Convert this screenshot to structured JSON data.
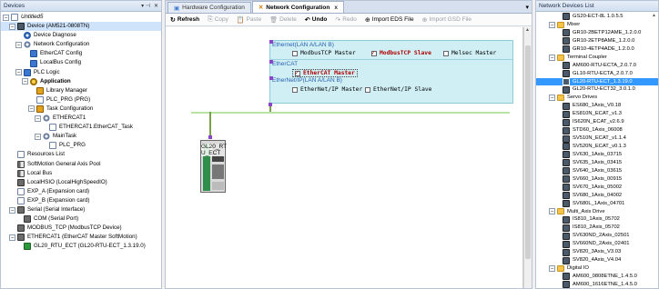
{
  "left_panel": {
    "title": "Devices",
    "header_icons": [
      "pin-icon",
      "close-icon"
    ],
    "items": [
      {
        "label": "Untitled5",
        "indent": 0,
        "exp": "-",
        "icon": "doc",
        "italic": true
      },
      {
        "label": "Device (AM521-0808TN)",
        "indent": 1,
        "exp": "-",
        "icon": "dev",
        "sel": true
      },
      {
        "label": "Device Diagnose",
        "indent": 2,
        "exp": "",
        "icon": "eth"
      },
      {
        "label": "Network Configuration",
        "indent": 2,
        "exp": "-",
        "icon": "gear"
      },
      {
        "label": "EtherCAT Config",
        "indent": 3,
        "exp": "",
        "icon": "blue"
      },
      {
        "label": "LocalBus Config",
        "indent": 3,
        "exp": "",
        "icon": "blue"
      },
      {
        "label": "PLC Logic",
        "indent": 2,
        "exp": "-",
        "icon": "blue"
      },
      {
        "label": "Application",
        "indent": 3,
        "exp": "-",
        "icon": "app",
        "bold": true
      },
      {
        "label": "Library Manager",
        "indent": 4,
        "exp": "",
        "icon": "lib"
      },
      {
        "label": "PLC_PRG (PRG)",
        "indent": 4,
        "exp": "",
        "icon": "doc"
      },
      {
        "label": "Task Configuration",
        "indent": 4,
        "exp": "-",
        "icon": "lib"
      },
      {
        "label": "ETHERCAT1",
        "indent": 5,
        "exp": "-",
        "icon": "gear"
      },
      {
        "label": "ETHERCAT1.EtherCAT_Task",
        "indent": 6,
        "exp": "",
        "icon": "doc"
      },
      {
        "label": "MainTask",
        "indent": 5,
        "exp": "-",
        "icon": "gear"
      },
      {
        "label": "PLC_PRG",
        "indent": 6,
        "exp": "",
        "icon": "doc"
      },
      {
        "label": "Resources List",
        "indent": 1,
        "exp": "",
        "icon": "doc"
      },
      {
        "label": "SoftMotion General Axis Pool",
        "indent": 1,
        "exp": "",
        "icon": "cable"
      },
      {
        "label": "Local Bus",
        "indent": 1,
        "exp": "",
        "icon": "cable"
      },
      {
        "label": "LocalHSIO (LocalHighSpeedIO)",
        "indent": 1,
        "exp": "",
        "icon": "chip"
      },
      {
        "label": "EXP_A (Expansion card)",
        "indent": 1,
        "exp": "",
        "icon": "doc"
      },
      {
        "label": "EXP_B (Expansion card)",
        "indent": 1,
        "exp": "",
        "icon": "doc"
      },
      {
        "label": "Serial (Serial Interface)",
        "indent": 1,
        "exp": "-",
        "icon": "chip"
      },
      {
        "label": "COM (Serial Port)",
        "indent": 2,
        "exp": "",
        "icon": "chip"
      },
      {
        "label": "MODBUS_TCP (ModbusTCP Device)",
        "indent": 1,
        "exp": "",
        "icon": "chip"
      },
      {
        "label": "ETHERCAT1 (EtherCAT Master SoftMotion)",
        "indent": 1,
        "exp": "-",
        "icon": "chip"
      },
      {
        "label": "GL20_RTU_ECT (GL20-RTU-ECT_1.3.19.0)",
        "indent": 2,
        "exp": "",
        "icon": "green"
      }
    ]
  },
  "center": {
    "tabs": [
      {
        "label": "Hardware Configuration",
        "active": false
      },
      {
        "label": "Network Configuration",
        "active": true,
        "close": "x"
      }
    ],
    "toolbar": [
      {
        "label": "Refresh",
        "icon": "↻",
        "enabled": true,
        "bold": true
      },
      {
        "label": "Copy",
        "icon": "⎘",
        "enabled": false
      },
      {
        "label": "Paste",
        "icon": "📋",
        "enabled": false
      },
      {
        "label": "Delete",
        "icon": "🗑",
        "enabled": false
      },
      {
        "label": "Undo",
        "icon": "↶",
        "enabled": true,
        "bold": true
      },
      {
        "label": "Redo",
        "icon": "↷",
        "enabled": false
      },
      {
        "label": "Import EDS File",
        "icon": "⊕",
        "enabled": true
      },
      {
        "label": "Import GSD File",
        "icon": "⊕",
        "enabled": false
      }
    ],
    "protocols": {
      "ethernet_header": "Ethernet(LAN A/LAN B)",
      "modbus_master": "ModbusTCP Master",
      "modbus_slave": "ModbusTCP Slave",
      "melsec_master": "Melsec Master",
      "ethercat_header": "EtherCAT",
      "ethercat_master": "EtherCAT Master",
      "ethernetip_header": "EtherNet/IP(LAN A/LAN B)",
      "ethernetip_master": "EtherNet/IP Master",
      "ethernetip_slave": "EtherNet/IP Slave"
    },
    "checked": {
      "modbus_master": false,
      "modbus_slave": true,
      "melsec_master": false,
      "ethercat_master": true,
      "ethernetip_master": false,
      "ethernetip_slave": false
    },
    "bus_label": "EtherCAT",
    "device_label": "GL20_RT U_ECT"
  },
  "right_panel": {
    "title": "Network Devices List",
    "items": [
      {
        "label": "GS20-ECT-8L 1.0.5.5",
        "indent": 3,
        "exp": "",
        "icon": "dev"
      },
      {
        "label": "Mixer",
        "indent": 2,
        "exp": "-",
        "icon": "folder"
      },
      {
        "label": "GR10-2BETP12AME_1.2.0.0",
        "indent": 3,
        "exp": "",
        "icon": "dev"
      },
      {
        "label": "GR10-2ETP8AME_1.2.0.0",
        "indent": 3,
        "exp": "",
        "icon": "dev"
      },
      {
        "label": "GR10-4ETP4ADE_1.2.0.0",
        "indent": 3,
        "exp": "",
        "icon": "dev"
      },
      {
        "label": "Terminal Coupler",
        "indent": 2,
        "exp": "-",
        "icon": "folder"
      },
      {
        "label": "AM600-RTU-ECTA_2.0.7.0",
        "indent": 3,
        "exp": "",
        "icon": "dev"
      },
      {
        "label": "GL10-RTU-ECTA_2.0.7.0",
        "indent": 3,
        "exp": "",
        "icon": "dev"
      },
      {
        "label": "GL20-RTU-ECT_1.3.19.0",
        "indent": 3,
        "exp": "",
        "icon": "dev",
        "sel": true
      },
      {
        "label": "GL20-RTU-ECT32_3.0.1.0",
        "indent": 3,
        "exp": "",
        "icon": "dev"
      },
      {
        "label": "Servo Drives",
        "indent": 2,
        "exp": "-",
        "icon": "folder"
      },
      {
        "label": "ES680_1Axis_V0.18",
        "indent": 3,
        "exp": "",
        "icon": "dev"
      },
      {
        "label": "ES810N_ECAT_v1.3",
        "indent": 3,
        "exp": "",
        "icon": "dev"
      },
      {
        "label": "IS620N_ECAT_v2.6.9",
        "indent": 3,
        "exp": "",
        "icon": "dev"
      },
      {
        "label": "STD60_1Axis_06008",
        "indent": 3,
        "exp": "",
        "icon": "dev"
      },
      {
        "label": "SV510N_ECAT_v1.1.4",
        "indent": 3,
        "exp": "",
        "icon": "dev"
      },
      {
        "label": "SV520N_ECAT_v0.1.3",
        "indent": 3,
        "exp": "",
        "icon": "dev"
      },
      {
        "label": "SV630_1Axis_03715",
        "indent": 3,
        "exp": "",
        "icon": "dev"
      },
      {
        "label": "SV635_1Axis_03415",
        "indent": 3,
        "exp": "",
        "icon": "dev"
      },
      {
        "label": "SV640_1Axis_03615",
        "indent": 3,
        "exp": "",
        "icon": "dev"
      },
      {
        "label": "SV660_1Axis_00915",
        "indent": 3,
        "exp": "",
        "icon": "dev"
      },
      {
        "label": "SV670_1Axis_05002",
        "indent": 3,
        "exp": "",
        "icon": "dev"
      },
      {
        "label": "SV680_1Axis_04002",
        "indent": 3,
        "exp": "",
        "icon": "dev"
      },
      {
        "label": "SV680L_1Axis_04701",
        "indent": 3,
        "exp": "",
        "icon": "dev"
      },
      {
        "label": "Multi_Axis Drive",
        "indent": 2,
        "exp": "-",
        "icon": "folder"
      },
      {
        "label": "IS810_1Axis_05702",
        "indent": 3,
        "exp": "",
        "icon": "dev"
      },
      {
        "label": "IS810_2Axis_05702",
        "indent": 3,
        "exp": "",
        "icon": "dev"
      },
      {
        "label": "SV630ND_2Axis_02501",
        "indent": 3,
        "exp": "",
        "icon": "dev"
      },
      {
        "label": "SV660ND_2Axis_02401",
        "indent": 3,
        "exp": "",
        "icon": "dev"
      },
      {
        "label": "SV820_3Axis_V3.03",
        "indent": 3,
        "exp": "",
        "icon": "dev"
      },
      {
        "label": "SV820_4Axis_V4.04",
        "indent": 3,
        "exp": "",
        "icon": "dev"
      },
      {
        "label": "Digital IO",
        "indent": 2,
        "exp": "-",
        "icon": "folder"
      },
      {
        "label": "AM600_0808ETNE_1.4.5.0",
        "indent": 3,
        "exp": "",
        "icon": "dev"
      },
      {
        "label": "AM600_1616ETNE_1.4.5.0",
        "indent": 3,
        "exp": "",
        "icon": "dev"
      }
    ]
  }
}
